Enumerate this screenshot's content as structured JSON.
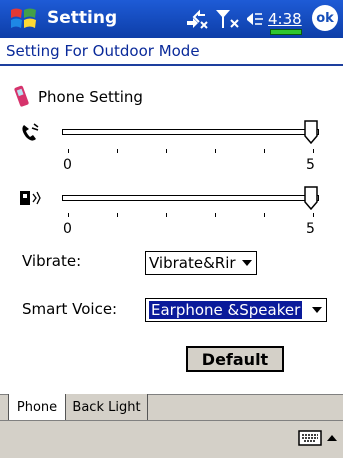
{
  "titlebar": {
    "app_title": "Setting",
    "clock": "4:38",
    "ok_label": "ok",
    "icons": [
      "start-logo-icon",
      "connectivity-icon",
      "signal-icon",
      "volume-icon",
      "battery-icon"
    ]
  },
  "header": {
    "title": "Setting For Outdoor Mode"
  },
  "section": {
    "title": "Phone Setting",
    "icon": "phone-icon"
  },
  "sliders": [
    {
      "name": "ring-volume",
      "icon": "phone-ringer-icon",
      "min_label": "0",
      "max_label": "5",
      "value": 5,
      "max": 5
    },
    {
      "name": "speaker-volume",
      "icon": "speaker-icon",
      "min_label": "0",
      "max_label": "5",
      "value": 5,
      "max": 5
    }
  ],
  "vibrate": {
    "label": "Vibrate:",
    "value": "Vibrate&Rir"
  },
  "smart_voice": {
    "label": "Smart Voice:",
    "value": "Earphone &Speaker"
  },
  "default_button": "Default",
  "tabs": [
    {
      "label": "Phone",
      "active": true
    },
    {
      "label": "Back Light",
      "active": false
    }
  ],
  "colors": {
    "titlebar": "#1e5bd6",
    "header_text": "#0a2a9a",
    "selection": "#0a1a9a",
    "chrome": "#d4d0c8"
  }
}
